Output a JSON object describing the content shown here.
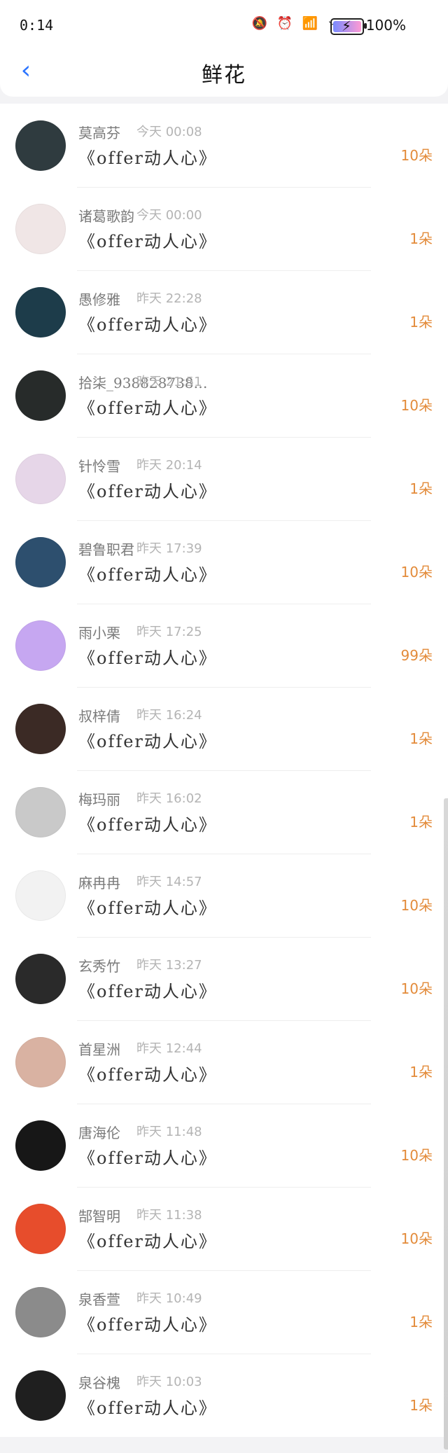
{
  "status": {
    "time": "0:14",
    "battery_text": "100%",
    "icons": [
      "bell-off-icon",
      "alarm-icon",
      "hd-signal-icon",
      "wifi-icon"
    ]
  },
  "nav": {
    "title": "鲜花"
  },
  "items": [
    {
      "name": "莫高芬",
      "time": "今天 00:08",
      "title": "《offer动人心》",
      "qty": "10朵",
      "avatar_color": "#2f3b3f"
    },
    {
      "name": "诸葛歌韵",
      "time": "今天 00:00",
      "title": "《offer动人心》",
      "qty": "1朵",
      "avatar_color": "#f0e6e6"
    },
    {
      "name": "愚修雅",
      "time": "昨天 22:28",
      "title": "《offer动人心》",
      "qty": "1朵",
      "avatar_color": "#1d3c4a"
    },
    {
      "name": "拾柒_938828738…",
      "time": "昨天 21:51",
      "title": "《offer动人心》",
      "qty": "10朵",
      "avatar_color": "#272b2a"
    },
    {
      "name": "针怜雪",
      "time": "昨天 20:14",
      "title": "《offer动人心》",
      "qty": "1朵",
      "avatar_color": "#e6d6e8"
    },
    {
      "name": "碧鲁职君",
      "time": "昨天 17:39",
      "title": "《offer动人心》",
      "qty": "10朵",
      "avatar_color": "#2d4f6e"
    },
    {
      "name": "雨小栗",
      "time": "昨天 17:25",
      "title": "《offer动人心》",
      "qty": "99朵",
      "avatar_color": "#c6a7f1"
    },
    {
      "name": "叔梓倩",
      "time": "昨天 16:24",
      "title": "《offer动人心》",
      "qty": "1朵",
      "avatar_color": "#3b2a25"
    },
    {
      "name": "梅玛丽",
      "time": "昨天 16:02",
      "title": "《offer动人心》",
      "qty": "1朵",
      "avatar_color": "#c9c9c9"
    },
    {
      "name": "麻冉冉",
      "time": "昨天 14:57",
      "title": "《offer动人心》",
      "qty": "10朵",
      "avatar_color": "#f2f2f2"
    },
    {
      "name": "玄秀竹",
      "time": "昨天 13:27",
      "title": "《offer动人心》",
      "qty": "10朵",
      "avatar_color": "#2a2a2a"
    },
    {
      "name": "首星洲",
      "time": "昨天 12:44",
      "title": "《offer动人心》",
      "qty": "1朵",
      "avatar_color": "#d9b2a2"
    },
    {
      "name": "唐海伦",
      "time": "昨天 11:48",
      "title": "《offer动人心》",
      "qty": "10朵",
      "avatar_color": "#171717"
    },
    {
      "name": "郜智明",
      "time": "昨天 11:38",
      "title": "《offer动人心》",
      "qty": "10朵",
      "avatar_color": "#e74d2c"
    },
    {
      "name": "泉香萱",
      "time": "昨天 10:49",
      "title": "《offer动人心》",
      "qty": "1朵",
      "avatar_color": "#8b8b8b"
    },
    {
      "name": "泉谷槐",
      "time": "昨天 10:03",
      "title": "《offer动人心》",
      "qty": "1朵",
      "avatar_color": "#1f1f1f"
    }
  ]
}
